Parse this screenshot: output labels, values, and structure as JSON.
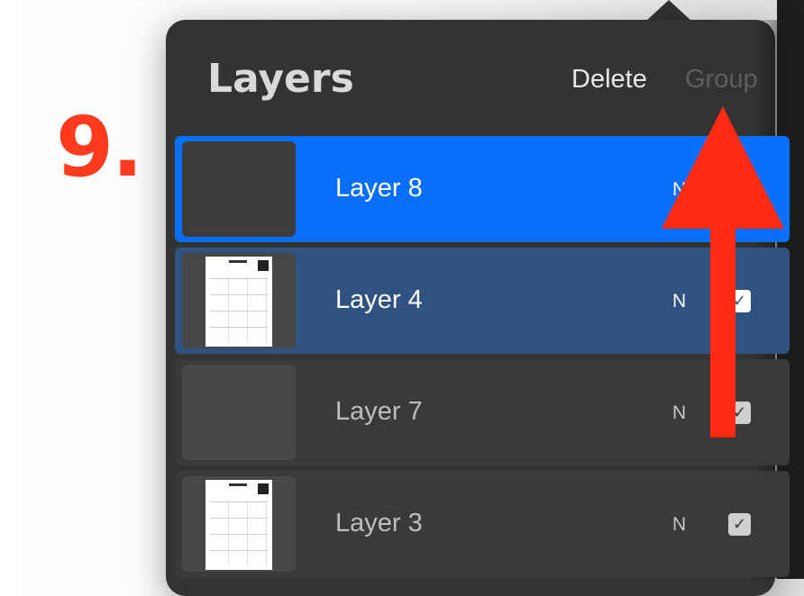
{
  "tutorial": {
    "step_label": "9."
  },
  "layers_panel": {
    "title": "Layers",
    "delete_label": "Delete",
    "group_label": "Group",
    "layers": [
      {
        "name": "Layer 8",
        "blend": "N",
        "state": "active",
        "thumbnail": "empty",
        "visible": true
      },
      {
        "name": "Layer 4",
        "blend": "N",
        "state": "selected",
        "thumbnail": "page",
        "visible": true
      },
      {
        "name": "Layer 7",
        "blend": "N",
        "state": "normal",
        "thumbnail": "empty",
        "visible": true
      },
      {
        "name": "Layer 3",
        "blend": "N",
        "state": "normal",
        "thumbnail": "page",
        "visible": true
      }
    ]
  },
  "colors": {
    "accent_active": "#0a6ff8",
    "accent_selected": "#2f5281",
    "annotation_red": "#ff3b1f"
  },
  "icons": {
    "visibility_checkbox": "checkmark-icon",
    "annotation_arrow": "arrow-up-icon"
  }
}
